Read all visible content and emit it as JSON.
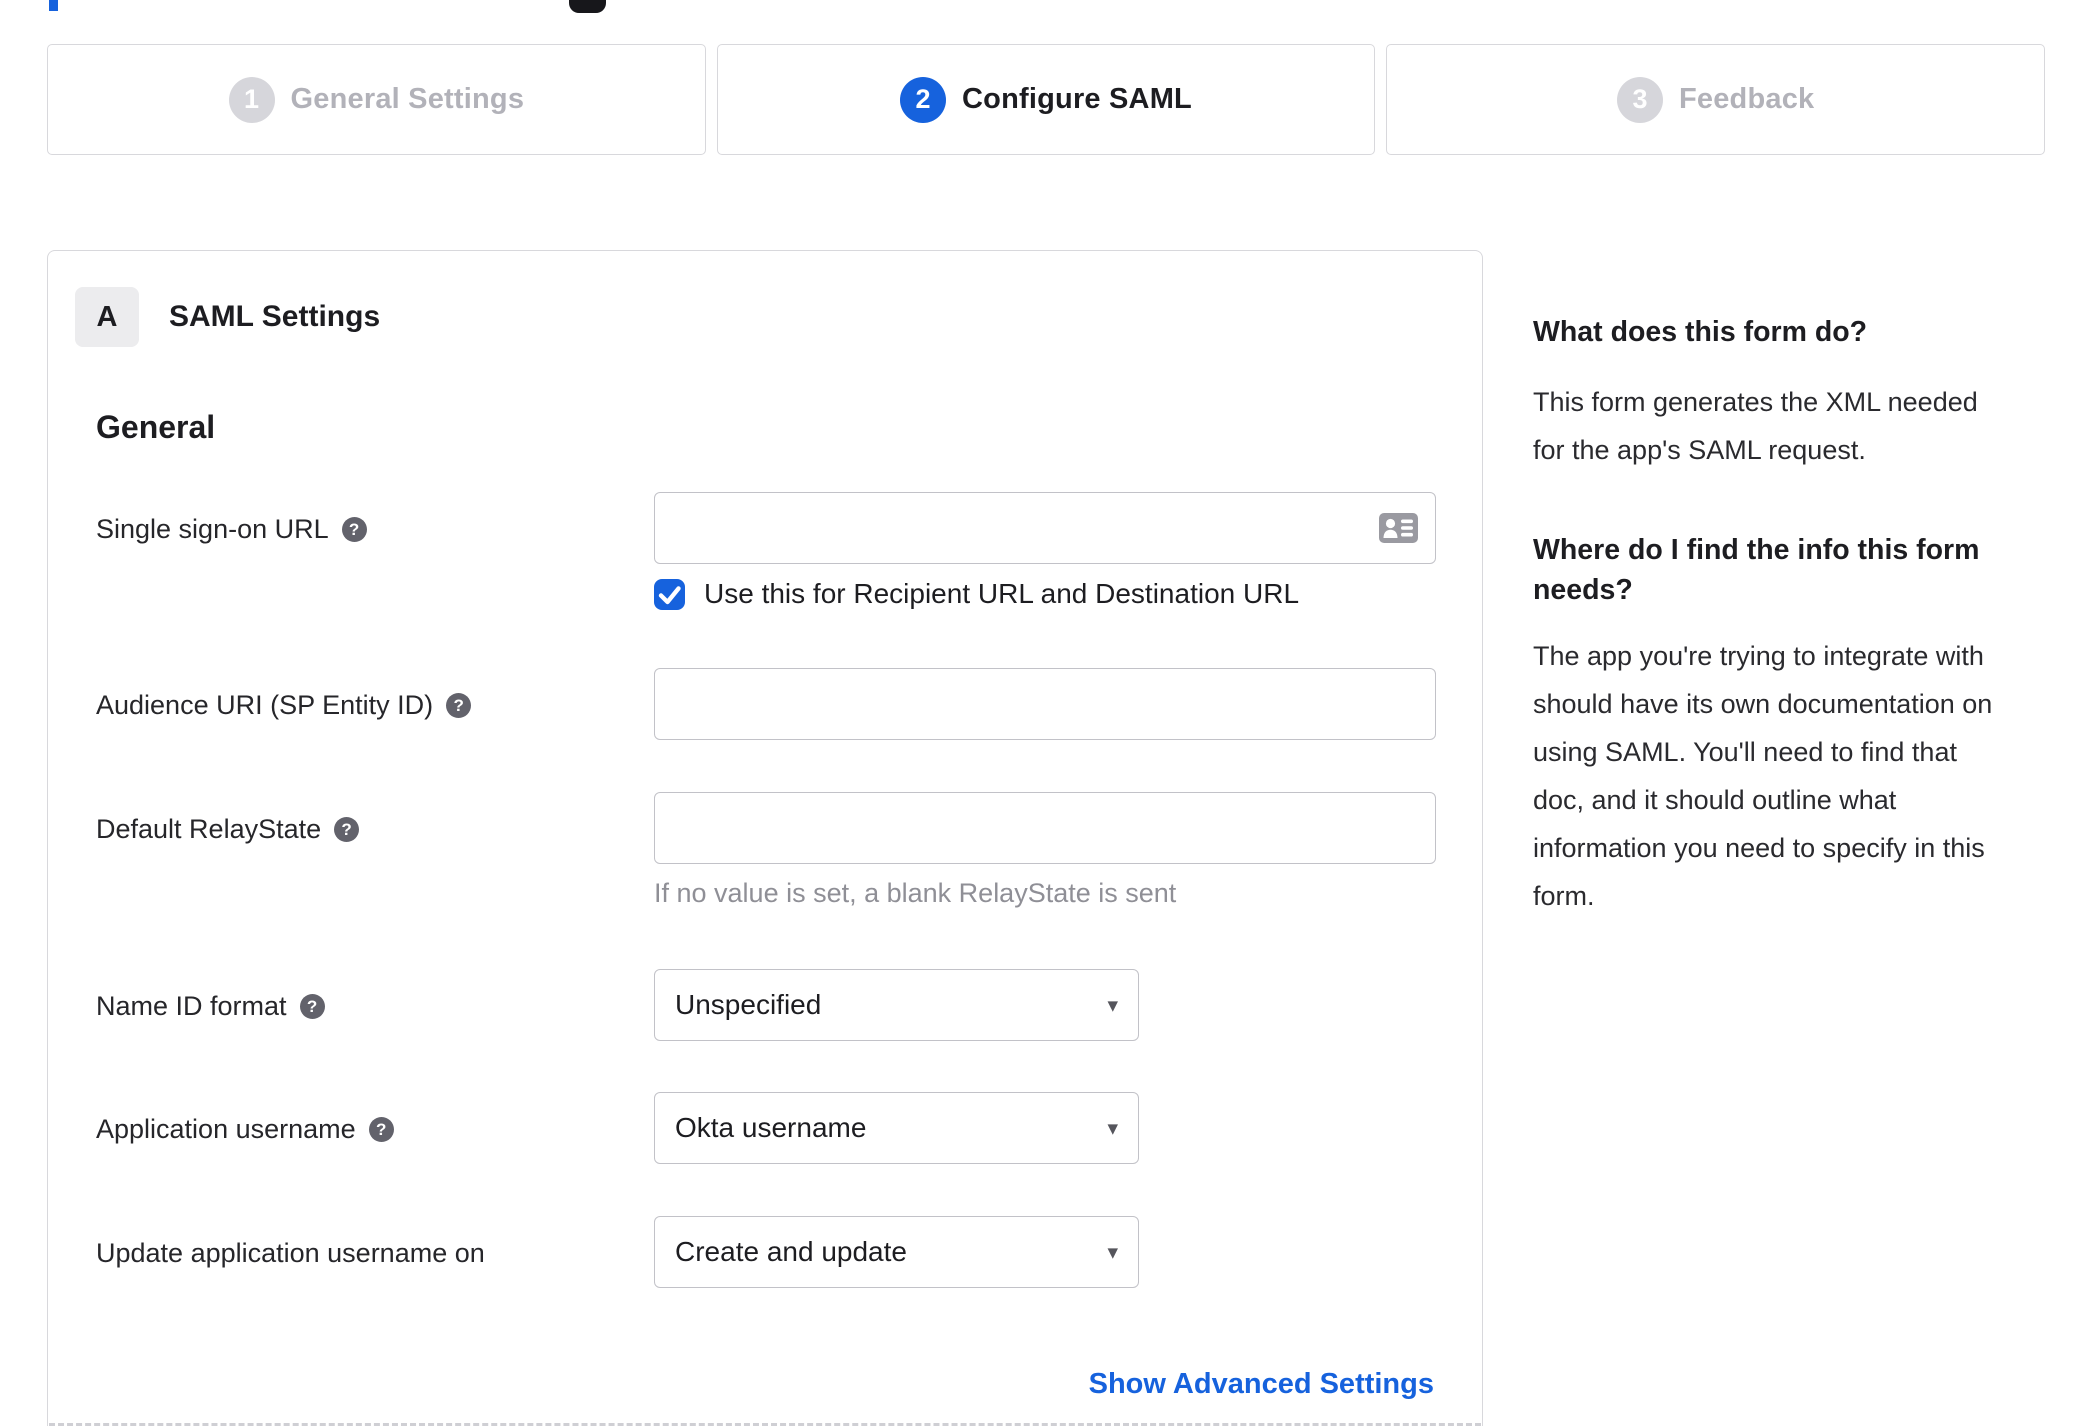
{
  "colors": {
    "accent_blue": "#1662dd",
    "inactive_step_gray": "#d6d6db",
    "border_gray": "#d8d8dc",
    "input_border": "#c2c2c8",
    "hint_gray": "#8f8f96"
  },
  "stepper": {
    "steps": [
      {
        "number": "1",
        "label": "General Settings",
        "state": "inactive"
      },
      {
        "number": "2",
        "label": "Configure SAML",
        "state": "active"
      },
      {
        "number": "3",
        "label": "Feedback",
        "state": "inactive"
      }
    ]
  },
  "panel": {
    "section_badge": "A",
    "section_title": "SAML Settings",
    "general_heading": "General",
    "fields": [
      {
        "label": "Single sign-on URL",
        "has_help": true,
        "type": "text",
        "value": "",
        "checkbox_label": "Use this for Recipient URL and Destination URL",
        "checkbox_checked": true
      },
      {
        "label": "Audience URI (SP Entity ID)",
        "has_help": true,
        "type": "text",
        "value": ""
      },
      {
        "label": "Default RelayState",
        "has_help": true,
        "type": "text",
        "value": "",
        "hint": "If no value is set, a blank RelayState is sent"
      },
      {
        "label": "Name ID format",
        "has_help": true,
        "type": "select",
        "value": "Unspecified"
      },
      {
        "label": "Application username",
        "has_help": true,
        "type": "select",
        "value": "Okta username"
      },
      {
        "label": "Update application username on",
        "has_help": false,
        "type": "select",
        "value": "Create and update"
      }
    ],
    "advanced_link": "Show Advanced Settings"
  },
  "help_panel": {
    "q1": "What does this form do?",
    "a1": "This form generates the XML needed for the app's SAML request.",
    "q2": "Where do I find the info this form needs?",
    "a2": "The app you're trying to integrate with should have its own documentation on using SAML. You'll need to find that doc, and it should outline what information you need to specify in this form."
  },
  "icons": {
    "help": "?",
    "select_caret": "▾"
  }
}
